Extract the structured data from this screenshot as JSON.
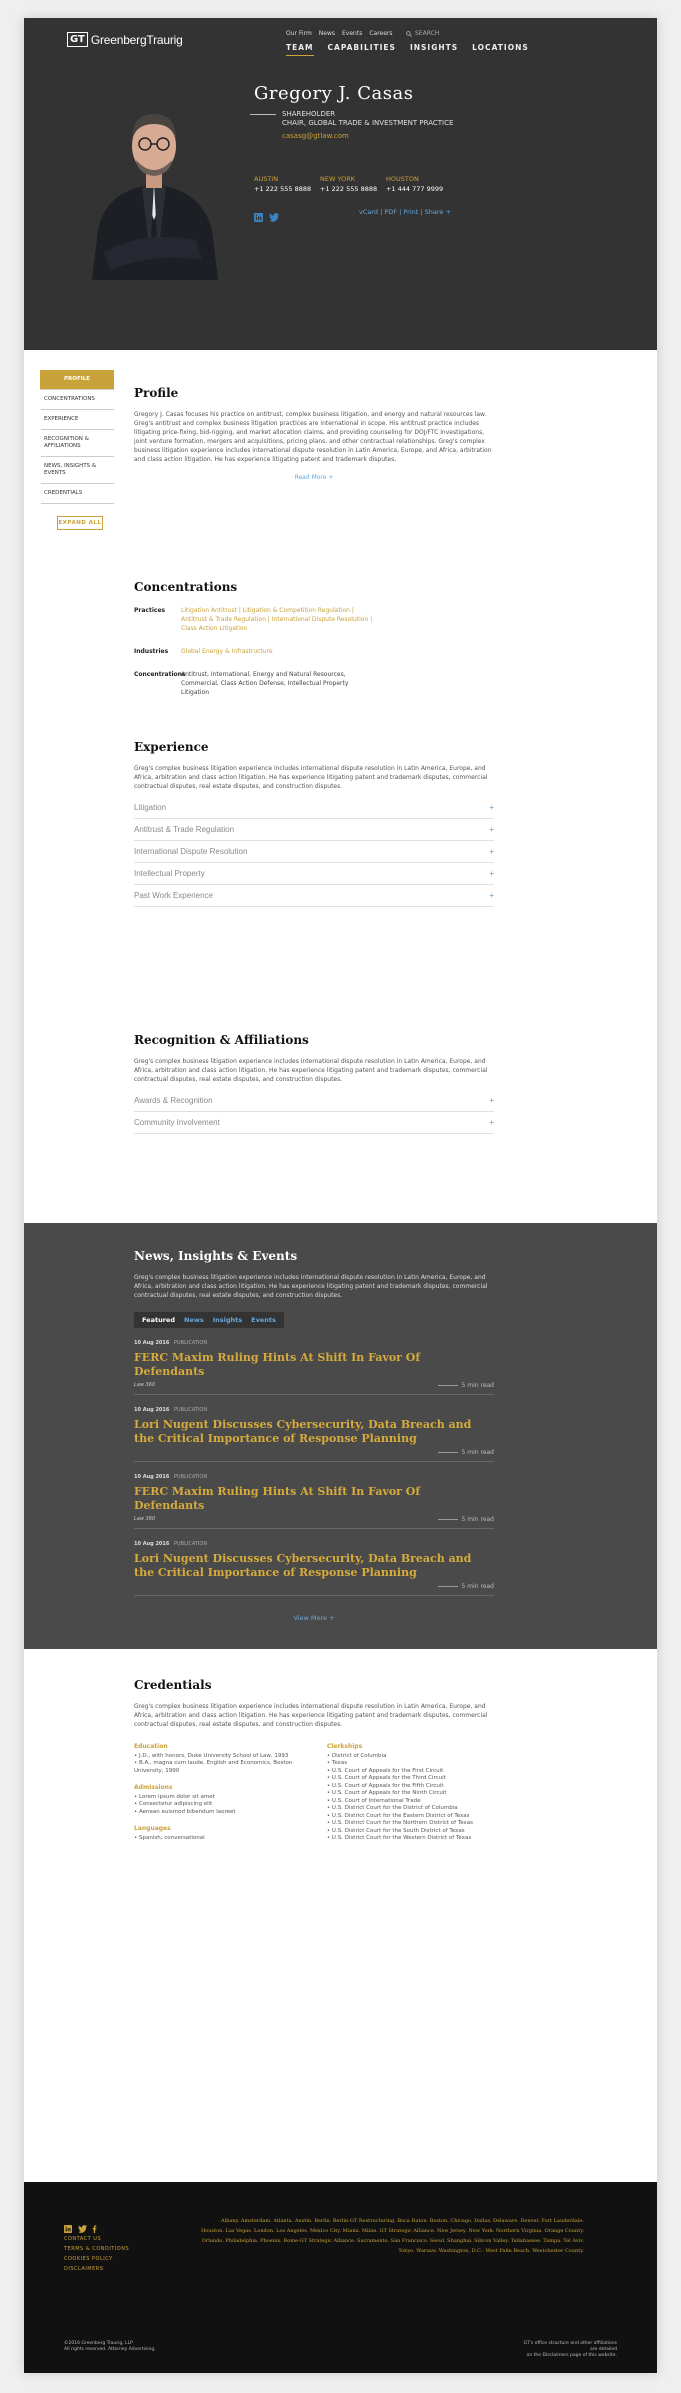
{
  "header": {
    "logo_mark": "GT",
    "logo_word": "GreenbergTraurig",
    "util_nav": [
      "Our Firm",
      "News",
      "Events",
      "Careers"
    ],
    "search_label": "SEARCH",
    "main_nav": [
      "TEAM",
      "CAPABILITIES",
      "INSIGHTS",
      "LOCATIONS"
    ]
  },
  "profile": {
    "name": "Gregory J. Casas",
    "title1": "SHAREHOLDER",
    "title2": "CHAIR, GLOBAL TRADE & INVESTMENT PRACTICE",
    "email": "casasg@gtlaw.com",
    "offices": [
      {
        "city": "AUSTIN",
        "phone": "+1 222 555 8888"
      },
      {
        "city": "NEW YORK",
        "phone": "+1 222 555 8888"
      },
      {
        "city": "HOUSTON",
        "phone": "+1 444 777 9999"
      }
    ],
    "doc_links": "vCard | PDF | Print | Share +"
  },
  "sidenav": {
    "items": [
      "PROFILE",
      "CONCENTRATIONS",
      "EXPERIENCE",
      "RECOGNITION & AFFILIATIONS",
      "NEWS, INSIGHTS & EVENTS",
      "CREDENTIALS"
    ],
    "expand_all": "EXPAND ALL"
  },
  "profile_section": {
    "heading": "Profile",
    "body": "Gregory J. Casas focuses his practice on antitrust, complex business litigation, and energy and natural resources law. Greg's antitrust and complex business litigation practices are international in scope. His antitrust practice includes litigating price-fixing, bid-rigging, and market allocation claims, and providing counseling for DOJ/FTC investigations, joint venture formation, mergers and acquisitions, pricing plans, and other contractual relationships. Greg's complex business litigation experience includes international dispute resolution in Latin America, Europe, and Africa, arbitration and class action litigation. He has experience litigating patent and trademark disputes,",
    "read_more": "Read More +"
  },
  "concentrations": {
    "heading": "Concentrations",
    "practices_label": "Practices",
    "practices": "Litigation Antitrust  |  Litigation & Competition Regulation  |  Antitrust & Trade Regulation  |  International Dispute Resolution  |  Class Action Litigation",
    "industries_label": "Industries",
    "industries": "Global Energy & Infrastructure",
    "conc_label": "Concentrations",
    "conc": "Antitrust, International, Energy and Natural Resources, Commercial, Class Action Defense, Intellectual Property Litigation"
  },
  "experience": {
    "heading": "Experience",
    "body": "Greg's complex business litigation experience includes international dispute resolution in Latin America, Europe, and Africa, arbitration and class action litigation. He has experience litigating patent and trademark disputes, commercial contractual disputes, real estate disputes, and construction disputes.",
    "items": [
      "Litigation",
      "Antitrust & Trade Regulation",
      "International Dispute Resolution",
      "Intellectual Property",
      "Past Work Experience"
    ]
  },
  "recognition": {
    "heading": "Recognition & Affiliations",
    "body": "Greg's complex business litigation experience includes international dispute resolution in Latin America, Europe, and Africa, arbitration and class action litigation. He has experience litigating patent and trademark disputes, commercial contractual disputes, real estate disputes, and construction disputes.",
    "items": [
      "Awards & Recognition",
      "Community Involvement"
    ]
  },
  "news": {
    "heading": "News, Insights & Events",
    "body": "Greg's complex business litigation experience includes international dispute resolution in Latin America, Europe, and Africa, arbitration and class action litigation. He has experience litigating patent and trademark disputes, commercial contractual disputes, real estate disputes, and construction disputes.",
    "tabs": [
      "Featured",
      "News",
      "Insights",
      "Events"
    ],
    "articles": [
      {
        "date": "10 Aug 2016",
        "type": "PUBLICATION",
        "title": "FERC Maxim Ruling Hints At Shift In Favor Of Defendants",
        "source": "Law 360",
        "readtime": "5 min read"
      },
      {
        "date": "10 Aug 2016",
        "type": "PUBLICATION",
        "title": "Lori Nugent Discusses Cybersecurity, Data Breach and the Critical Importance of Response Planning",
        "source": "",
        "readtime": "5 min read"
      },
      {
        "date": "10 Aug 2016",
        "type": "PUBLICATION",
        "title": "FERC Maxim Ruling Hints At Shift In Favor Of Defendants",
        "source": "Law 360",
        "readtime": "5 min read"
      },
      {
        "date": "10 Aug 2016",
        "type": "PUBLICATION",
        "title": "Lori Nugent Discusses Cybersecurity, Data Breach and the Critical Importance of Response Planning",
        "source": "",
        "readtime": "5 min read"
      }
    ],
    "view_more": "View More +"
  },
  "credentials": {
    "heading": "Credentials",
    "body": "Greg's complex business litigation experience includes international dispute resolution in Latin America, Europe, and Africa, arbitration and class action litigation. He has experience litigating patent and trademark disputes, commercial contractual disputes, real estate disputes, and construction disputes.",
    "education_h": "Education",
    "education": [
      "• J.D., with honors, Duke University School of Law, 1993",
      "• B.A., magna cum laude, English and Economics, Boston University, 1990"
    ],
    "admissions_h": "Admissions",
    "admissions": [
      "• Lorem ipsum dolor sit amet",
      "• Consectetur adipiscing elit",
      "• Aenean euismod bibendum laoreet"
    ],
    "languages_h": "Languages",
    "languages": [
      "• Spanish, conversational"
    ],
    "clerkships_h": "Clerkships",
    "clerkships": [
      "• District of Columbia",
      "• Texas",
      "• U.S. Court of Appeals for the First Circuit",
      "• U.S. Court of Appeals for the Third Circuit",
      "• U.S. Court of Appeals for the Fifth Circuit",
      "• U.S. Court of Appeals for the Ninth Circuit",
      "• U.S. Court of International Trade",
      "• U.S. District Court for the District of Columbia",
      "• U.S. District Court for the Eastern District of Texas",
      "• U.S. District Court for the Northern District of Texas",
      "• U.S. District Court for the South District of Texas",
      "• U.S. District Court for the Western District of Texas"
    ]
  },
  "footer": {
    "links": [
      "CONTACT US",
      "TERMS & CONDITIONS",
      "COOKIES POLICY",
      "DISCLAIMERS"
    ],
    "offices": "Albany. Amsterdam. Atlanta. Austin. Berlin. Berlin-GT Restructuring. Boca Raton. Boston. Chicago. Dallas. Delaware. Denver. Fort Lauderdale. Houston. Las Vegas. London. Los Angeles. Mexico City. Miami. Milan. GT Strategic Alliance. New Jersey. New York. Northern Virginia. Orange County. Orlando. Philadelphia. Phoenix. Rome-GT Strategic Alliance. Sacramento. San Francisco. Seoul. Shanghai. Silicon Valley. Tallahassee. Tampa. Tel Aviv. Tokyo. Warsaw. Washington, D.C.. West Palm Beach. Westchester County.",
    "copy1": "©2016 Greenberg Traurig, LLP",
    "copy2": "All rights reserved. Attorney Advertising.",
    "note1": "GT's office structure and other affiliations are detailed",
    "note2": "on the Disclaimers page of this website."
  },
  "colors": {
    "gold": "#c9a239",
    "link_blue": "#6aa7d9",
    "dark": "#333333"
  }
}
